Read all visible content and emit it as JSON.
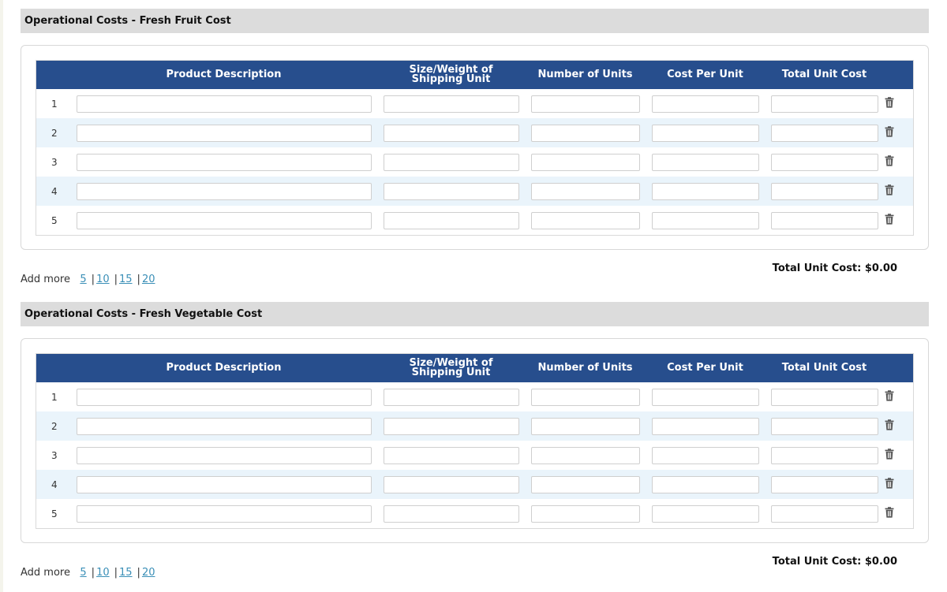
{
  "sections": [
    {
      "title": "Operational Costs - Fresh Fruit Cost",
      "columns": [
        "Product Description",
        "Size/Weight of Shipping Unit",
        "Number of Units",
        "Cost Per Unit",
        "Total Unit Cost"
      ],
      "rows": [
        {
          "num": "1",
          "values": [
            "",
            "",
            "",
            "",
            ""
          ]
        },
        {
          "num": "2",
          "values": [
            "",
            "",
            "",
            "",
            ""
          ]
        },
        {
          "num": "3",
          "values": [
            "",
            "",
            "",
            "",
            ""
          ]
        },
        {
          "num": "4",
          "values": [
            "",
            "",
            "",
            "",
            ""
          ]
        },
        {
          "num": "5",
          "values": [
            "",
            "",
            "",
            "",
            ""
          ]
        }
      ],
      "total_label": "Total Unit Cost:",
      "total_value": "$0.00",
      "add_more_label": "Add more",
      "add_more_options": [
        "5",
        "10",
        "15",
        "20"
      ]
    },
    {
      "title": "Operational Costs - Fresh Vegetable Cost",
      "columns": [
        "Product Description",
        "Size/Weight of Shipping Unit",
        "Number of Units",
        "Cost Per Unit",
        "Total Unit Cost"
      ],
      "rows": [
        {
          "num": "1",
          "values": [
            "",
            "",
            "",
            "",
            ""
          ]
        },
        {
          "num": "2",
          "values": [
            "",
            "",
            "",
            "",
            ""
          ]
        },
        {
          "num": "3",
          "values": [
            "",
            "",
            "",
            "",
            ""
          ]
        },
        {
          "num": "4",
          "values": [
            "",
            "",
            "",
            "",
            ""
          ]
        },
        {
          "num": "5",
          "values": [
            "",
            "",
            "",
            "",
            ""
          ]
        }
      ],
      "total_label": "Total Unit Cost:",
      "total_value": "$0.00",
      "add_more_label": "Add more",
      "add_more_options": [
        "5",
        "10",
        "15",
        "20"
      ]
    }
  ],
  "icons": {
    "row_delete": "trash-icon"
  },
  "colors": {
    "header_bg": "#274e8d",
    "section_bg": "#dcdcdc",
    "row_alt": "#eaf4fb",
    "link": "#3a8fb7"
  }
}
